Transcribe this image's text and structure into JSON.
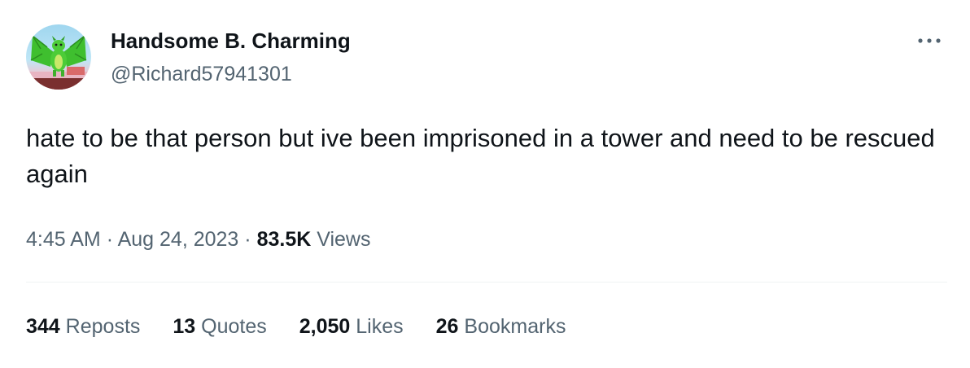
{
  "user": {
    "display_name": "Handsome B. Charming",
    "handle": "@Richard57941301",
    "avatar_icon": "green-dragon-avatar"
  },
  "tweet": {
    "text": "hate to be that person but ive been imprisoned in a tower and need to be rescued again",
    "time": "4:45 AM",
    "date": "Aug 24, 2023",
    "separator": "·",
    "views_count": "83.5K",
    "views_label": "Views"
  },
  "stats": {
    "reposts": {
      "count": "344",
      "label": "Reposts"
    },
    "quotes": {
      "count": "13",
      "label": "Quotes"
    },
    "likes": {
      "count": "2,050",
      "label": "Likes"
    },
    "bookmarks": {
      "count": "26",
      "label": "Bookmarks"
    }
  },
  "colors": {
    "text_primary": "#0f1419",
    "text_secondary": "#536471",
    "divider": "#eff3f4"
  },
  "icons": {
    "more": "more-horizontal-icon"
  }
}
